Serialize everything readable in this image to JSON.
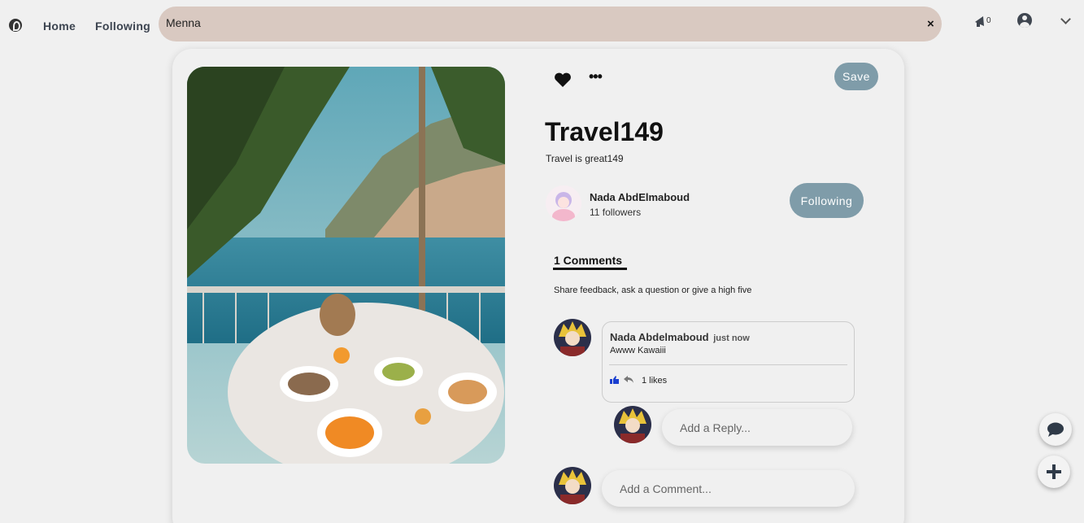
{
  "nav": {
    "home": "Home",
    "following": "Following",
    "search_value": "Menna",
    "clear_icon": "×",
    "notification_count": "0"
  },
  "pin": {
    "save_label": "Save",
    "title": "Travel149",
    "description": "Travel is great149",
    "more_icon": "•••"
  },
  "author": {
    "name": "Nada AbdElmaboud",
    "followers": "11 followers",
    "follow_label": "Following"
  },
  "comments": {
    "tab_label": "1 Comments",
    "prompt": "Share feedback, ask a question or give a high five",
    "items": [
      {
        "name": "Nada Abdelmaboud",
        "time": "just now",
        "text": "Awww Kawaiii",
        "likes": "1 likes"
      }
    ],
    "reply_placeholder": "Add a Reply...",
    "comment_placeholder": "Add a Comment..."
  },
  "colors": {
    "accent": "#7f9ca9",
    "search_bg": "#d9c9c1",
    "page_bg": "#f0f0f0"
  }
}
